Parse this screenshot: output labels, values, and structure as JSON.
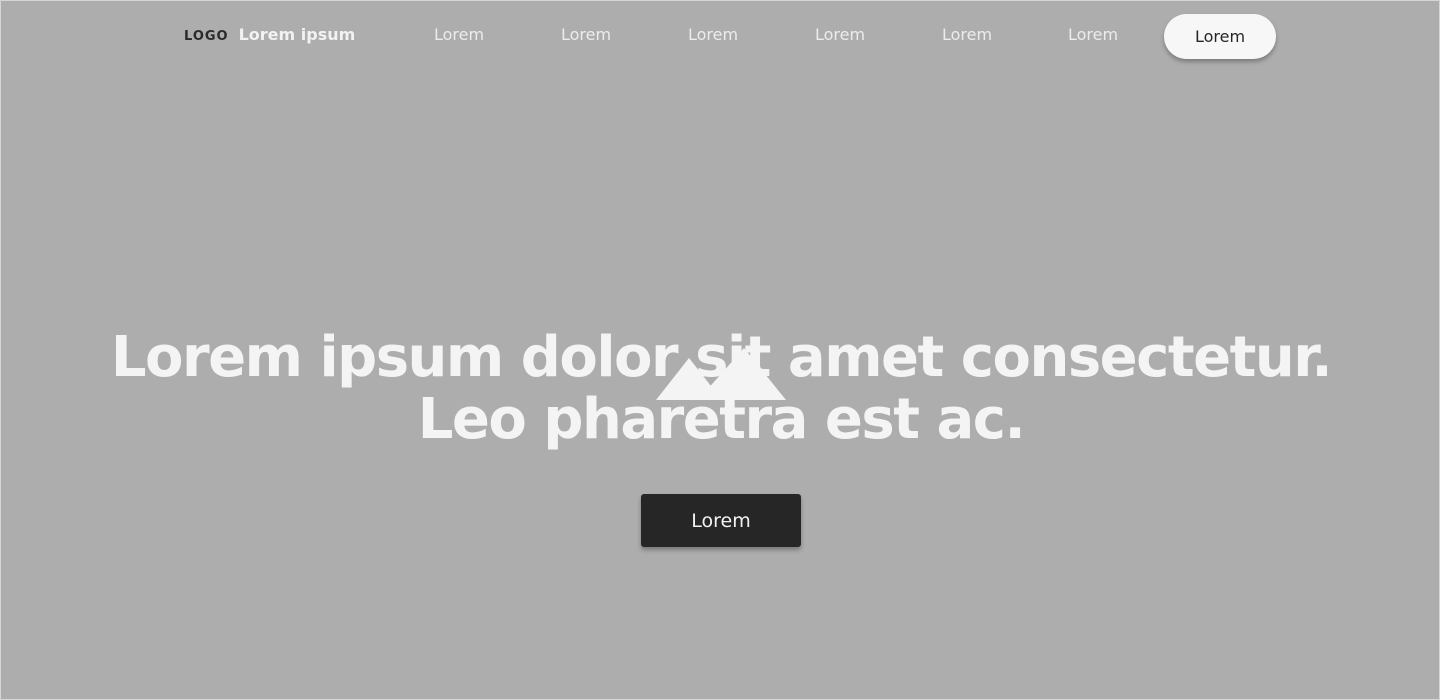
{
  "nav": {
    "logo": "LOGO",
    "brand": "Lorem ipsum",
    "links": [
      "Lorem",
      "Lorem",
      "Lorem",
      "Lorem",
      "Lorem",
      "Lorem"
    ],
    "cta": "Lorem"
  },
  "hero": {
    "image_icon": "mountain-image-icon",
    "headline_line1": "Lorem ipsum dolor sit amet consectetur.",
    "headline_line2": "Leo pharetra est ac.",
    "cta": "Lorem"
  },
  "colors": {
    "background": "#adadad",
    "text_light": "#f4f4f4",
    "button_dark": "#262626",
    "button_light": "#f7f7f7"
  }
}
